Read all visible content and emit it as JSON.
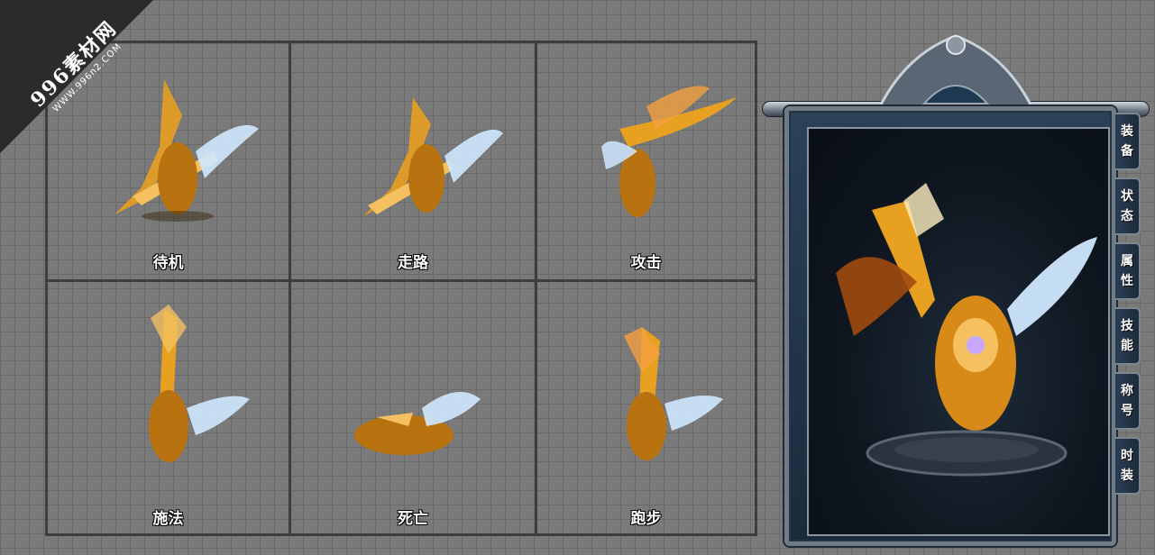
{
  "watermark": {
    "main": "996素材网",
    "sub": "WWW.996n2.COM"
  },
  "states": [
    {
      "id": "idle",
      "label": "待机"
    },
    {
      "id": "walk",
      "label": "走路"
    },
    {
      "id": "attack",
      "label": "攻击"
    },
    {
      "id": "cast",
      "label": "施法"
    },
    {
      "id": "death",
      "label": "死亡"
    },
    {
      "id": "run",
      "label": "跑步"
    }
  ],
  "panel": {
    "tabs": [
      {
        "c1": "装",
        "c2": "备"
      },
      {
        "c1": "状",
        "c2": "态"
      },
      {
        "c1": "属",
        "c2": "性"
      },
      {
        "c1": "技",
        "c2": "能"
      },
      {
        "c1": "称",
        "c2": "号"
      },
      {
        "c1": "时",
        "c2": "装"
      }
    ]
  },
  "colors": {
    "grid_bg": "#7a7a7a",
    "frame_border": "#6f7b86",
    "panel_bg": "#1a2a3a",
    "gold": "#e8a020",
    "wing": "#cfe8ff"
  }
}
